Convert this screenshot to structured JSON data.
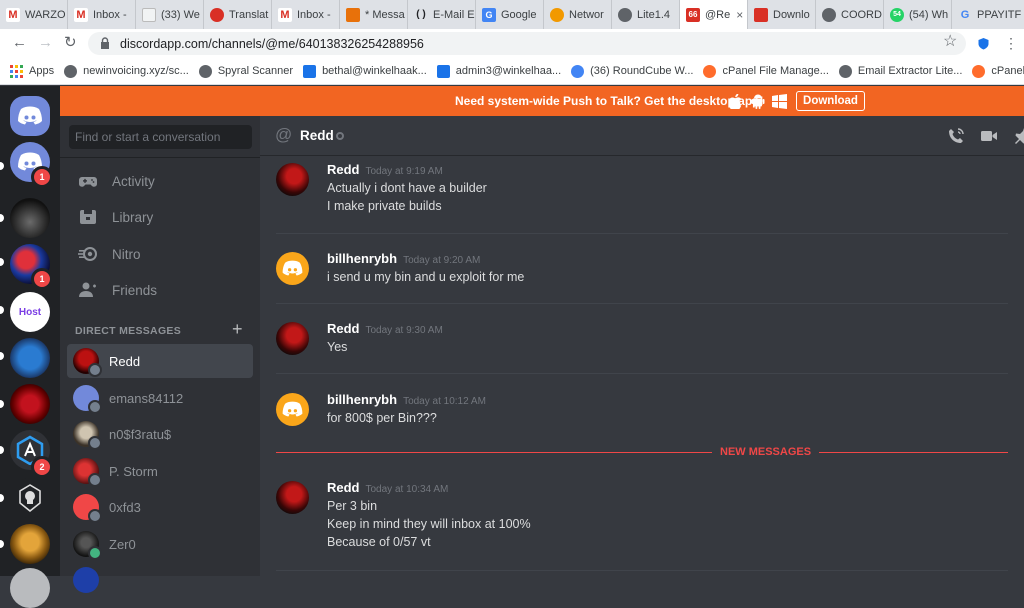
{
  "browser": {
    "tabs": [
      {
        "label": "WARZO",
        "favicon": "M",
        "color": "#d93025"
      },
      {
        "label": "Inbox -",
        "favicon": "M",
        "color": "#d93025"
      },
      {
        "label": "(33) We",
        "favicon": "",
        "color": "#9aa0a6"
      },
      {
        "label": "Translat",
        "favicon": "",
        "color": "#d93025"
      },
      {
        "label": "Inbox -",
        "favicon": "M",
        "color": "#d93025"
      },
      {
        "label": "* Messa",
        "favicon": "",
        "color": "#e8710a"
      },
      {
        "label": "E-Mail E",
        "favicon": "( )",
        "color": "#202124"
      },
      {
        "label": "Google",
        "favicon": "G",
        "color": "#4285f4"
      },
      {
        "label": "Networ",
        "favicon": "",
        "color": "#f29900"
      },
      {
        "label": "Lite1.4",
        "favicon": "",
        "color": "#5f6368"
      },
      {
        "label": "@Re",
        "favicon": "66",
        "color": "#d93025",
        "active": true
      },
      {
        "label": "Downlo",
        "favicon": "",
        "color": "#d93025"
      },
      {
        "label": "COORD",
        "favicon": "",
        "color": "#5f6368"
      },
      {
        "label": "(54) Wh",
        "favicon": "54",
        "color": "#25d366"
      },
      {
        "label": "PPAYITF",
        "favicon": "G",
        "color": "#4285f4"
      }
    ],
    "active_tab_close": "×",
    "url": "discordapp.com/channels/@me/640138326254288956",
    "bookmarks": [
      {
        "label": "Apps",
        "color": "#ea4335"
      },
      {
        "label": "newinvoicing.xyz/sc...",
        "color": "#5f6368"
      },
      {
        "label": "Spyral Scanner",
        "color": "#5f6368"
      },
      {
        "label": "bethal@winkelhaak...",
        "color": "#1a73e8"
      },
      {
        "label": "admin3@winkelhaa...",
        "color": "#1a73e8"
      },
      {
        "label": "(36) RoundCube W...",
        "color": "#4285f4"
      },
      {
        "label": "cPanel File Manage...",
        "color": "#ff6c2c"
      },
      {
        "label": "Email Extractor Lite...",
        "color": "#5f6368"
      },
      {
        "label": "cPanel File Man",
        "color": "#ff6c2c"
      }
    ]
  },
  "banner": {
    "text": "Need system-wide Push to Talk? Get the desktop app!",
    "download_label": "Download"
  },
  "servers": [
    {
      "badge": "1"
    },
    {
      "badge": ""
    },
    {
      "badge": "1"
    },
    {
      "badge": ""
    },
    {
      "badge": ""
    },
    {
      "badge": ""
    },
    {
      "badge": "2"
    },
    {
      "badge": ""
    },
    {
      "badge": ""
    }
  ],
  "server_labels": {
    "host": "Host"
  },
  "sidebar": {
    "search_placeholder": "Find or start a conversation",
    "nav": [
      {
        "label": "Activity",
        "icon": "gamepad-icon"
      },
      {
        "label": "Library",
        "icon": "library-icon"
      },
      {
        "label": "Nitro",
        "icon": "nitro-icon"
      },
      {
        "label": "Friends",
        "icon": "friends-icon"
      }
    ],
    "dm_header": "DIRECT MESSAGES",
    "dm_add": "+",
    "dms": [
      {
        "name": "Redd",
        "active": true,
        "status": "offline"
      },
      {
        "name": "emans84112",
        "status": "offline"
      },
      {
        "name": "n0$f3ratu$",
        "status": "offline"
      },
      {
        "name": "P. Storm",
        "status": "offline"
      },
      {
        "name": "0xfd3",
        "status": "offline"
      },
      {
        "name": "Zer0",
        "status": "online"
      }
    ]
  },
  "chat": {
    "title": "Redd",
    "at": "@",
    "new_messages_label": "NEW MESSAGES",
    "messages": [
      {
        "author": "Redd",
        "time": "Today at 9:19 AM",
        "lines": [
          "Actually i dont have a builder",
          "I make private builds"
        ],
        "avatar": "redd"
      },
      {
        "author": "billhenrybh",
        "time": "Today at 9:20 AM",
        "lines": [
          "i send u my bin and u exploit for me"
        ],
        "avatar": "discord"
      },
      {
        "author": "Redd",
        "time": "Today at 9:30 AM",
        "lines": [
          "Yes"
        ],
        "avatar": "redd"
      },
      {
        "author": "billhenrybh",
        "time": "Today at 10:12 AM",
        "lines": [
          "for 800$ per Bin???"
        ],
        "avatar": "discord"
      },
      {
        "author": "Redd",
        "time": "Today at 10:34 AM",
        "lines": [
          "Per 3 bin",
          "Keep in mind they will inbox at 100%",
          "Because of 0/57 vt"
        ],
        "avatar": "redd"
      }
    ]
  },
  "colors": {
    "blurple": "#7289da",
    "orange": "#f26522",
    "danger": "#f04747",
    "online": "#43b581"
  }
}
